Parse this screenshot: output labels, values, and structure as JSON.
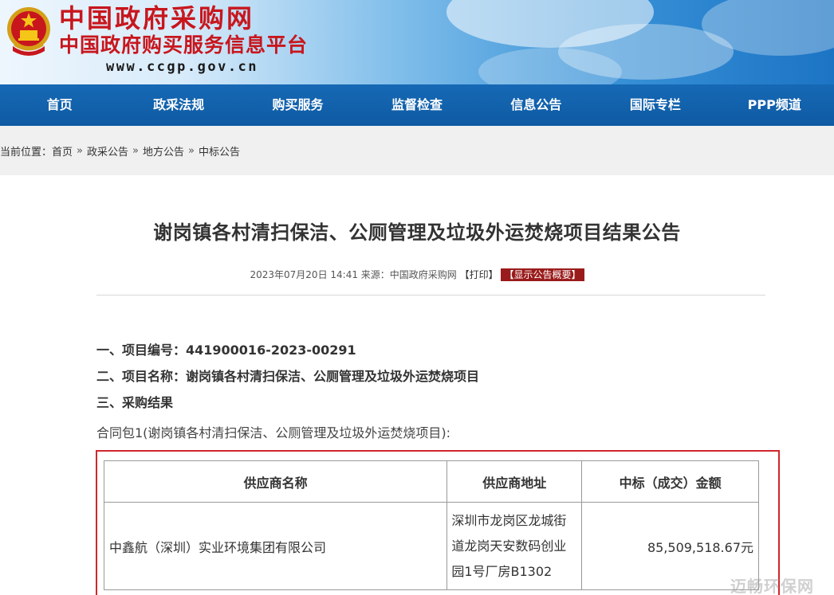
{
  "header": {
    "title": "中国政府采购网",
    "subtitle": "中国政府购买服务信息平台",
    "url": "www.ccgp.gov.cn",
    "emblem_icon": "national-emblem-icon"
  },
  "nav": {
    "items": [
      {
        "label": "首页"
      },
      {
        "label": "政采法规"
      },
      {
        "label": "购买服务"
      },
      {
        "label": "监督检查"
      },
      {
        "label": "信息公告"
      },
      {
        "label": "国际专栏"
      },
      {
        "label": "PPP频道"
      }
    ]
  },
  "breadcrumb": {
    "prefix": "当前位置：",
    "items": [
      "首页",
      "政采公告",
      "地方公告",
      "中标公告"
    ],
    "separator": "»"
  },
  "article": {
    "title": "谢岗镇各村清扫保洁、公厕管理及垃圾外运焚烧项目结果公告",
    "meta_datetime": "2023年07月20日 14:41",
    "meta_source": "来源：中国政府采购网",
    "print_label": "【打印】",
    "summary_label": "【显示公告概要】",
    "field1": "一、项目编号：441900016-2023-00291",
    "field2": "二、项目名称：谢岗镇各村清扫保洁、公厕管理及垃圾外运焚烧项目",
    "field3": "三、采购结果",
    "package_line": "合同包1(谢岗镇各村清扫保洁、公厕管理及垃圾外运焚烧项目):"
  },
  "table": {
    "headers": [
      "供应商名称",
      "供应商地址",
      "中标（成交）金额"
    ],
    "rows": [
      {
        "supplier": "中鑫航（深圳）实业环境集团有限公司",
        "address": "深圳市龙岗区龙城街道龙岗天安数码创业园1号厂房B1302",
        "amount": "85,509,518.67元"
      }
    ]
  },
  "watermark": "迈畅环保网",
  "colors": {
    "nav_bg": "#0f5aa3",
    "title_red": "#c8161d",
    "highlight_frame": "#d0262b",
    "summary_btn": "#9a1b1b"
  }
}
